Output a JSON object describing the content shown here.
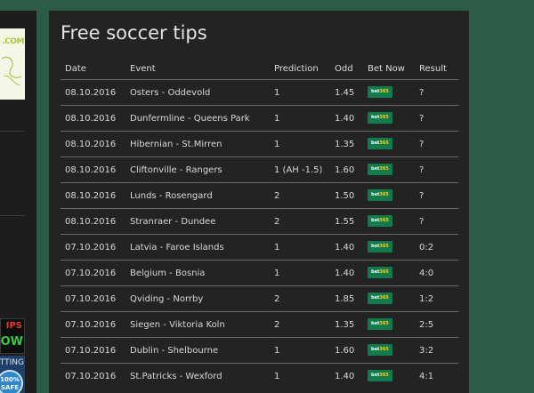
{
  "sidebar": {
    "logo_text": ".COM",
    "banner_tips": "IPS",
    "banner_now": "OW",
    "banner_betting": "TTING",
    "banner_badge_line1": "100%",
    "banner_badge_line2": "SAFE"
  },
  "main": {
    "title": "Free soccer tips",
    "columns": [
      "Date",
      "Event",
      "Prediction",
      "Odd",
      "Bet Now",
      "Result"
    ],
    "bookmaker": {
      "name_part1": "bet",
      "name_part2": "365",
      "color": "#137a4e"
    },
    "rows": [
      {
        "date": "08.10.2016",
        "event": "Osters - Oddevold",
        "prediction": "1",
        "odd": "1.45",
        "result": "?"
      },
      {
        "date": "08.10.2016",
        "event": "Dunfermline - Queens Park",
        "prediction": "1",
        "odd": "1.40",
        "result": "?"
      },
      {
        "date": "08.10.2016",
        "event": "Hibernian - St.Mirren",
        "prediction": "1",
        "odd": "1.35",
        "result": "?"
      },
      {
        "date": "08.10.2016",
        "event": "Cliftonville - Rangers",
        "prediction": "1 (AH -1.5)",
        "odd": "1.60",
        "result": "?"
      },
      {
        "date": "08.10.2016",
        "event": "Lunds - Rosengard",
        "prediction": "2",
        "odd": "1.50",
        "result": "?"
      },
      {
        "date": "08.10.2016",
        "event": "Stranraer - Dundee",
        "prediction": "2",
        "odd": "1.55",
        "result": "?"
      },
      {
        "date": "07.10.2016",
        "event": "Latvia - Faroe Islands",
        "prediction": "1",
        "odd": "1.40",
        "result": "0:2"
      },
      {
        "date": "07.10.2016",
        "event": "Belgium - Bosnia",
        "prediction": "1",
        "odd": "1.40",
        "result": "4:0"
      },
      {
        "date": "07.10.2016",
        "event": "Qviding - Norrby",
        "prediction": "2",
        "odd": "1.85",
        "result": "1:2"
      },
      {
        "date": "07.10.2016",
        "event": "Siegen - Viktoria Koln",
        "prediction": "2",
        "odd": "1.35",
        "result": "2:5"
      },
      {
        "date": "07.10.2016",
        "event": "Dublin - Shelbourne",
        "prediction": "1",
        "odd": "1.60",
        "result": "3:2"
      },
      {
        "date": "07.10.2016",
        "event": "St.Patricks - Wexford",
        "prediction": "1",
        "odd": "1.40",
        "result": "4:1"
      }
    ]
  }
}
